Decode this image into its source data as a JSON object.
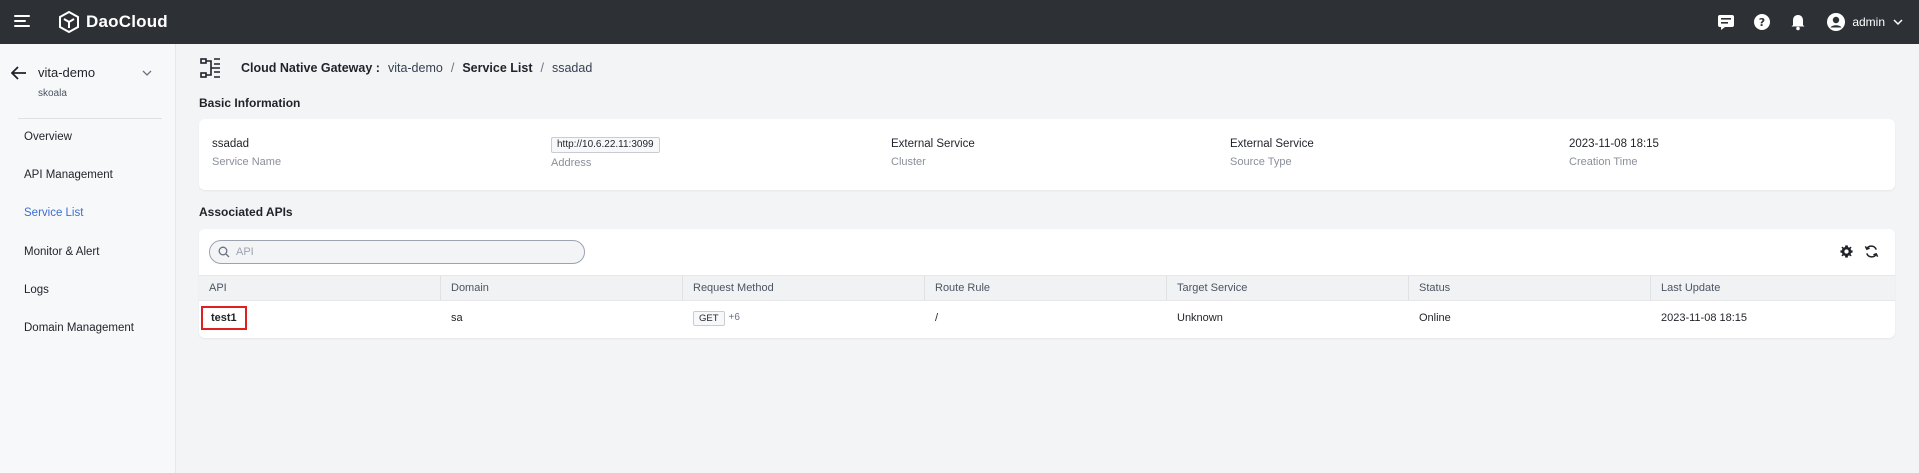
{
  "topbar": {
    "brand": "DaoCloud",
    "user_name": "admin",
    "icons": [
      "menu-icon",
      "message-icon",
      "help-icon",
      "bell-icon",
      "user-avatar-icon",
      "chevron-down-icon"
    ]
  },
  "sidebar": {
    "workspace": "vita-demo",
    "workspace_sub": "skoala",
    "items": [
      {
        "label": "Overview",
        "active": false
      },
      {
        "label": "API Management",
        "active": false
      },
      {
        "label": "Service List",
        "active": true
      },
      {
        "label": "Monitor & Alert",
        "active": false
      },
      {
        "label": "Logs",
        "active": false
      },
      {
        "label": "Domain Management",
        "active": false
      }
    ]
  },
  "breadcrumb": {
    "title": "Cloud Native Gateway :",
    "gateway": "vita-demo",
    "sep": "/",
    "service_list": "Service List",
    "current": "ssadad"
  },
  "basic_info": {
    "title": "Basic Information",
    "items": [
      {
        "value": "ssadad",
        "label": "Service Name"
      },
      {
        "value": "http://10.6.22.11:3099",
        "label": "Address"
      },
      {
        "value": "External Service",
        "label": "Cluster"
      },
      {
        "value": "External Service",
        "label": "Source Type"
      },
      {
        "value": "2023-11-08 18:15",
        "label": "Creation Time"
      }
    ]
  },
  "associated_apis": {
    "title": "Associated APIs",
    "search_placeholder": "API",
    "columns": [
      "API",
      "Domain",
      "Request Method",
      "Route Rule",
      "Target Service",
      "Status",
      "Last Update"
    ],
    "rows": [
      {
        "api": "test1",
        "domain": "sa",
        "method": "GET",
        "method_more": "+6",
        "route_rule": "/",
        "target_service": "Unknown",
        "status": "Online",
        "last_update": "2023-11-08 18:15"
      }
    ]
  },
  "colors": {
    "topbar": "#2d3034",
    "accent": "#3b6fd1",
    "highlight": "#e02020"
  }
}
